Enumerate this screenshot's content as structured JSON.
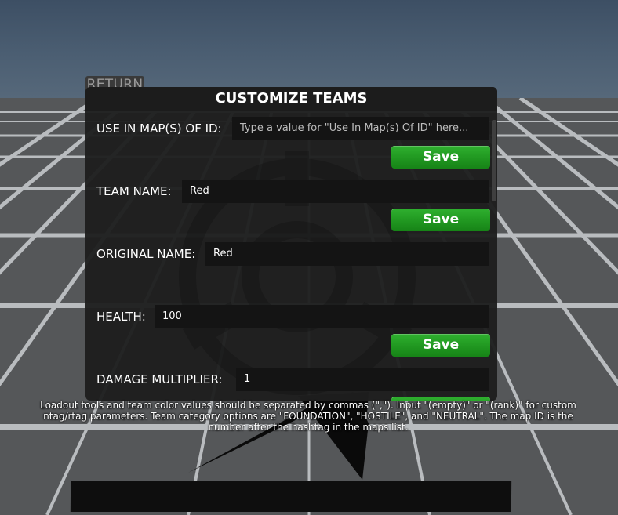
{
  "return_button": {
    "label": "RETURN"
  },
  "panel": {
    "title": "CUSTOMIZE TEAMS",
    "save_label": "Save",
    "rows": [
      {
        "label": "USE IN MAP(S) OF ID:",
        "value": "",
        "placeholder": "Type a value for \"Use In Map(s) Of ID\" here..."
      },
      {
        "label": "TEAM NAME:",
        "value": "Red",
        "placeholder": ""
      },
      {
        "label": "ORIGINAL NAME:",
        "value": "Red",
        "placeholder": ""
      },
      {
        "label": "HEALTH:",
        "value": "100",
        "placeholder": ""
      },
      {
        "label": "DAMAGE MULTIPLIER:",
        "value": "1",
        "placeholder": ""
      }
    ]
  },
  "footer_note": "Loadout tools and team color values should be separated by commas (\",\"). Input \"(empty)\" or \"(rank)\" for custom ntag/rtag parameters. Team category options are \"FOUNDATION\", \"HOSTILE\", and \"NEUTRAL\". The map ID is the number after the hashtag in the maps list.",
  "colors": {
    "panel_bg": "#1e1e1e",
    "field_bg": "#141414",
    "save_green": "#1f951f",
    "return_text": "#9a9a9a"
  },
  "icons": {
    "panel_logo": "scp-foundation-logo-icon"
  }
}
